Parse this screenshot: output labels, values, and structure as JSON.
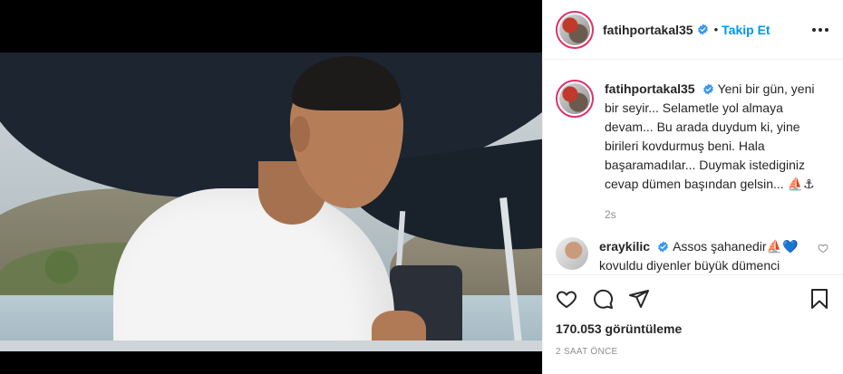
{
  "header": {
    "username": "fatihportakal35",
    "separator": "•",
    "follow_label": "Takip Et",
    "verified_icon": "verified-badge-icon",
    "more_icon": "more-options-icon"
  },
  "caption": {
    "username": "fatihportakal35",
    "text": "Yeni bir gün, yeni bir seyir... Selametle yol almaya devam... Bu arada duydum ki, yine birileri kovdurmuş beni. Hala başaramadılar... Duymak istediginiz cevap dümen başından gelsin... ⛵⚓",
    "time": "2s"
  },
  "comments": [
    {
      "username": "eraykilic",
      "text": "Assos şahanedir⛵💙 kovuldu diyenler büyük dümenci "
    }
  ],
  "actions": {
    "like_icon": "heart-icon",
    "comment_icon": "comment-icon",
    "share_icon": "share-icon",
    "save_icon": "bookmark-icon"
  },
  "stats": {
    "views": "170.053 görüntüleme",
    "posted": "2 SAAT ÖNCE"
  },
  "colors": {
    "link_blue": "#0095f6",
    "text": "#262626",
    "muted": "#8e8e8e",
    "border": "#efefef",
    "story_ring": "#e1306c"
  }
}
